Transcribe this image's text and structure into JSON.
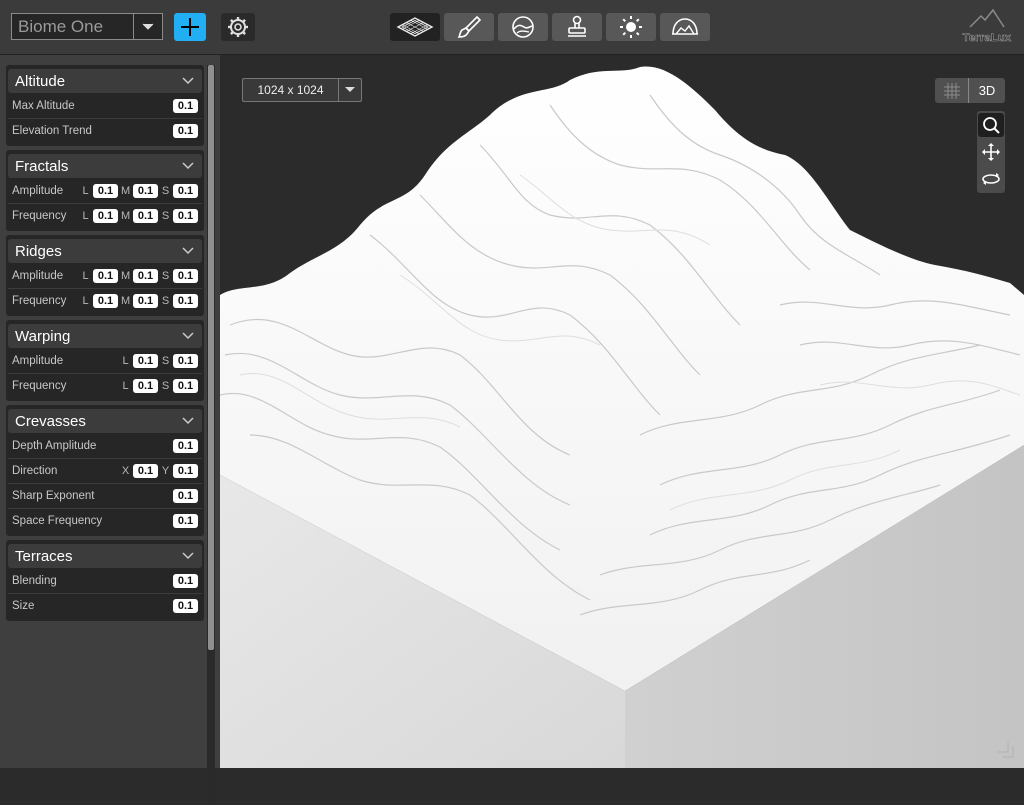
{
  "app": {
    "logo_text": "TerraLux"
  },
  "topbar": {
    "biome_value": "Biome One",
    "tools": [
      {
        "name": "terrain-tool",
        "icon": "terrain-grid-icon",
        "active": true
      },
      {
        "name": "paint-tool",
        "icon": "brush-icon",
        "active": false
      },
      {
        "name": "erosion-tool",
        "icon": "hill-circle-icon",
        "active": false
      },
      {
        "name": "stamp-tool",
        "icon": "stamp-icon",
        "active": false
      },
      {
        "name": "lighting-tool",
        "icon": "sun-icon",
        "active": false
      },
      {
        "name": "sky-tool",
        "icon": "dome-icon",
        "active": false
      }
    ]
  },
  "viewport": {
    "resolution": "1024 x 1024",
    "mode_label": "3D"
  },
  "panel": {
    "altitude": {
      "title": "Altitude",
      "max_altitude": {
        "label": "Max Altitude",
        "value": "0.1"
      },
      "elevation_trend": {
        "label": "Elevation Trend",
        "value": "0.1"
      }
    },
    "fractals": {
      "title": "Fractals",
      "amplitude": {
        "label": "Amplitude",
        "l_tag": "L",
        "l": "0.1",
        "m_tag": "M",
        "m": "0.1",
        "s_tag": "S",
        "s": "0.1"
      },
      "frequency": {
        "label": "Frequency",
        "l_tag": "L",
        "l": "0.1",
        "m_tag": "M",
        "m": "0.1",
        "s_tag": "S",
        "s": "0.1"
      }
    },
    "ridges": {
      "title": "Ridges",
      "amplitude": {
        "label": "Amplitude",
        "l_tag": "L",
        "l": "0.1",
        "m_tag": "M",
        "m": "0.1",
        "s_tag": "S",
        "s": "0.1"
      },
      "frequency": {
        "label": "Frequency",
        "l_tag": "L",
        "l": "0.1",
        "m_tag": "M",
        "m": "0.1",
        "s_tag": "S",
        "s": "0.1"
      }
    },
    "warping": {
      "title": "Warping",
      "amplitude": {
        "label": "Amplitude",
        "l_tag": "L",
        "l": "0.1",
        "s_tag": "S",
        "s": "0.1"
      },
      "frequency": {
        "label": "Frequency",
        "l_tag": "L",
        "l": "0.1",
        "s_tag": "S",
        "s": "0.1"
      }
    },
    "crevasses": {
      "title": "Crevasses",
      "depth_amplitude": {
        "label": "Depth Amplitude",
        "value": "0.1"
      },
      "direction": {
        "label": "Direction",
        "x_tag": "X",
        "x": "0.1",
        "y_tag": "Y",
        "y": "0.1"
      },
      "sharp_exponent": {
        "label": "Sharp Exponent",
        "value": "0.1"
      },
      "space_frequency": {
        "label": "Space Frequency",
        "value": "0.1"
      }
    },
    "terraces": {
      "title": "Terraces",
      "blending": {
        "label": "Blending",
        "value": "0.1"
      },
      "size": {
        "label": "Size",
        "value": "0.1"
      }
    }
  },
  "colors": {
    "accent": "#21aef2",
    "panel_bg": "#3f3f3f",
    "section_bg": "#262626",
    "viewport_bg": "#2b2b2b",
    "terrain": "#f2f2f2"
  }
}
